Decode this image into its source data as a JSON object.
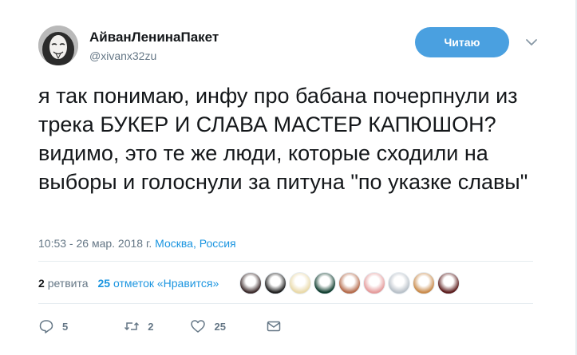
{
  "user": {
    "display_name": "АйванЛенинаПакет",
    "handle": "@xivanx32zu"
  },
  "follow_button": {
    "label": "Читаю"
  },
  "tweet": {
    "text": "я так понимаю, инфу про бабана почерпнули из трека БУКЕР И СЛАВА МАСТЕР КАПЮШОН? видимо, это те же люди, которые сходили на выборы и голоснули за питуна \"по указке славы\"",
    "timestamp": "10:53 - 26 мар. 2018 г.",
    "location": "Москва, Россия"
  },
  "stats": {
    "retweets_count": "2",
    "retweets_label": "ретвита",
    "likes_count": "25",
    "likes_label": "отметок «Нравится»"
  },
  "likers": [
    {
      "icon": "liker-avatar",
      "color": "#3b2a2a"
    },
    {
      "icon": "liker-avatar",
      "color": "#1d1d1d"
    },
    {
      "icon": "liker-avatar",
      "color": "#e9d9a8"
    },
    {
      "icon": "liker-avatar",
      "color": "#0f3d2e"
    },
    {
      "icon": "liker-avatar",
      "color": "#b46a4a"
    },
    {
      "icon": "liker-avatar",
      "color": "#e59b9b"
    },
    {
      "icon": "liker-avatar",
      "color": "#b8c0c8"
    },
    {
      "icon": "liker-avatar",
      "color": "#c98a4a"
    },
    {
      "icon": "liker-avatar",
      "color": "#5a1a1a"
    }
  ],
  "actions": {
    "reply_count": "5",
    "retweet_count": "2",
    "like_count": "25"
  },
  "colors": {
    "accent": "#1b95e0",
    "follow_button_bg": "#4aa0e0",
    "secondary_text": "#657786"
  }
}
